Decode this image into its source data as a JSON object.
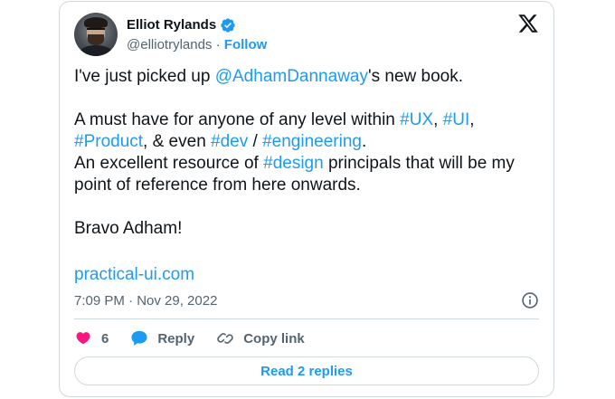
{
  "author": {
    "name": "Elliot Rylands",
    "handle": "@elliotrylands",
    "separator": " · ",
    "follow_label": "Follow"
  },
  "tweet": {
    "segments": [
      {
        "text": "I've just picked up ",
        "type": "text"
      },
      {
        "text": "@AdhamDannaway",
        "type": "tag"
      },
      {
        "text": "'s new book.\n\nA must have for anyone of any level within ",
        "type": "text"
      },
      {
        "text": "#UX",
        "type": "tag"
      },
      {
        "text": ", ",
        "type": "text"
      },
      {
        "text": "#UI",
        "type": "tag"
      },
      {
        "text": ",\n",
        "type": "text"
      },
      {
        "text": "#Product",
        "type": "tag"
      },
      {
        "text": ", & even ",
        "type": "text"
      },
      {
        "text": "#dev",
        "type": "tag"
      },
      {
        "text": " / ",
        "type": "text"
      },
      {
        "text": "#engineering",
        "type": "tag"
      },
      {
        "text": ".\nAn excellent resource of ",
        "type": "text"
      },
      {
        "text": "#design",
        "type": "tag"
      },
      {
        "text": " principals that will be my\npoint of reference from here onwards.\n\nBravo Adham!",
        "type": "text"
      }
    ],
    "link": "practical-ui.com",
    "timestamp": "7:09 PM · Nov 29, 2022"
  },
  "actions": {
    "like_count": "6",
    "reply_label": "Reply",
    "copy_label": "Copy link"
  },
  "read_replies_label": "Read 2 replies",
  "colors": {
    "accent": "#1d9bf0",
    "like": "#f91880",
    "text": "#0f1419",
    "muted": "#536471",
    "border": "#cfd9de"
  },
  "icons": [
    "verified-badge-icon",
    "x-logo-icon",
    "info-icon",
    "heart-icon",
    "reply-icon",
    "link-icon"
  ]
}
